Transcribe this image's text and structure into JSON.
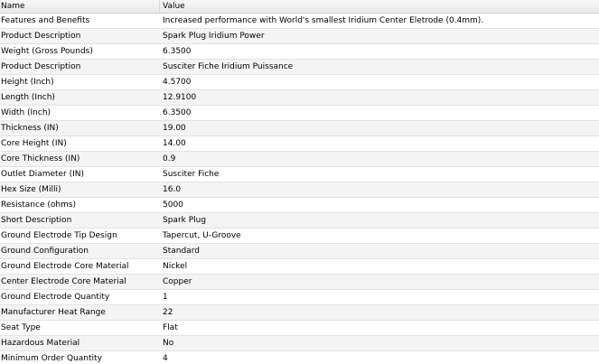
{
  "header": {
    "name_label": "Name",
    "value_label": "Value"
  },
  "rows": [
    {
      "name": "Features and Benefits",
      "value": "Increased performance with World's smallest Iridium Center Eletrode (0.4mm)."
    },
    {
      "name": "Product Description",
      "value": "Spark Plug Iridium Power"
    },
    {
      "name": "Weight (Gross Pounds)",
      "value": "6.3500"
    },
    {
      "name": "Product Description",
      "value": "Susciter Fiche Iridium Puissance"
    },
    {
      "name": "Height (Inch)",
      "value": "4.5700"
    },
    {
      "name": "Length (Inch)",
      "value": "12.9100"
    },
    {
      "name": "Width (Inch)",
      "value": "6.3500"
    },
    {
      "name": "Thickness (IN)",
      "value": "19.00"
    },
    {
      "name": "Core Height (IN)",
      "value": "14.00"
    },
    {
      "name": "Core Thickness (IN)",
      "value": "0.9"
    },
    {
      "name": "Outlet Diameter (IN)",
      "value": "Susciter Fiche"
    },
    {
      "name": "Hex Size (Milli)",
      "value": "16.0"
    },
    {
      "name": "Resistance (ohms)",
      "value": "5000"
    },
    {
      "name": "Short Description",
      "value": "Spark Plug"
    },
    {
      "name": "Ground Electrode Tip Design",
      "value": "Tapercut, U-Groove"
    },
    {
      "name": "Ground Configuration",
      "value": "Standard"
    },
    {
      "name": "Ground Electrode Core Material",
      "value": "Nickel"
    },
    {
      "name": "Center Electrode Core Material",
      "value": "Copper"
    },
    {
      "name": "Ground Electrode Quantity",
      "value": "1"
    },
    {
      "name": "Manufacturer Heat Range",
      "value": "22"
    },
    {
      "name": "Seat Type",
      "value": "Flat"
    },
    {
      "name": "Hazardous Material",
      "value": "No"
    },
    {
      "name": "Minimum Order Quantity",
      "value": "4"
    }
  ]
}
